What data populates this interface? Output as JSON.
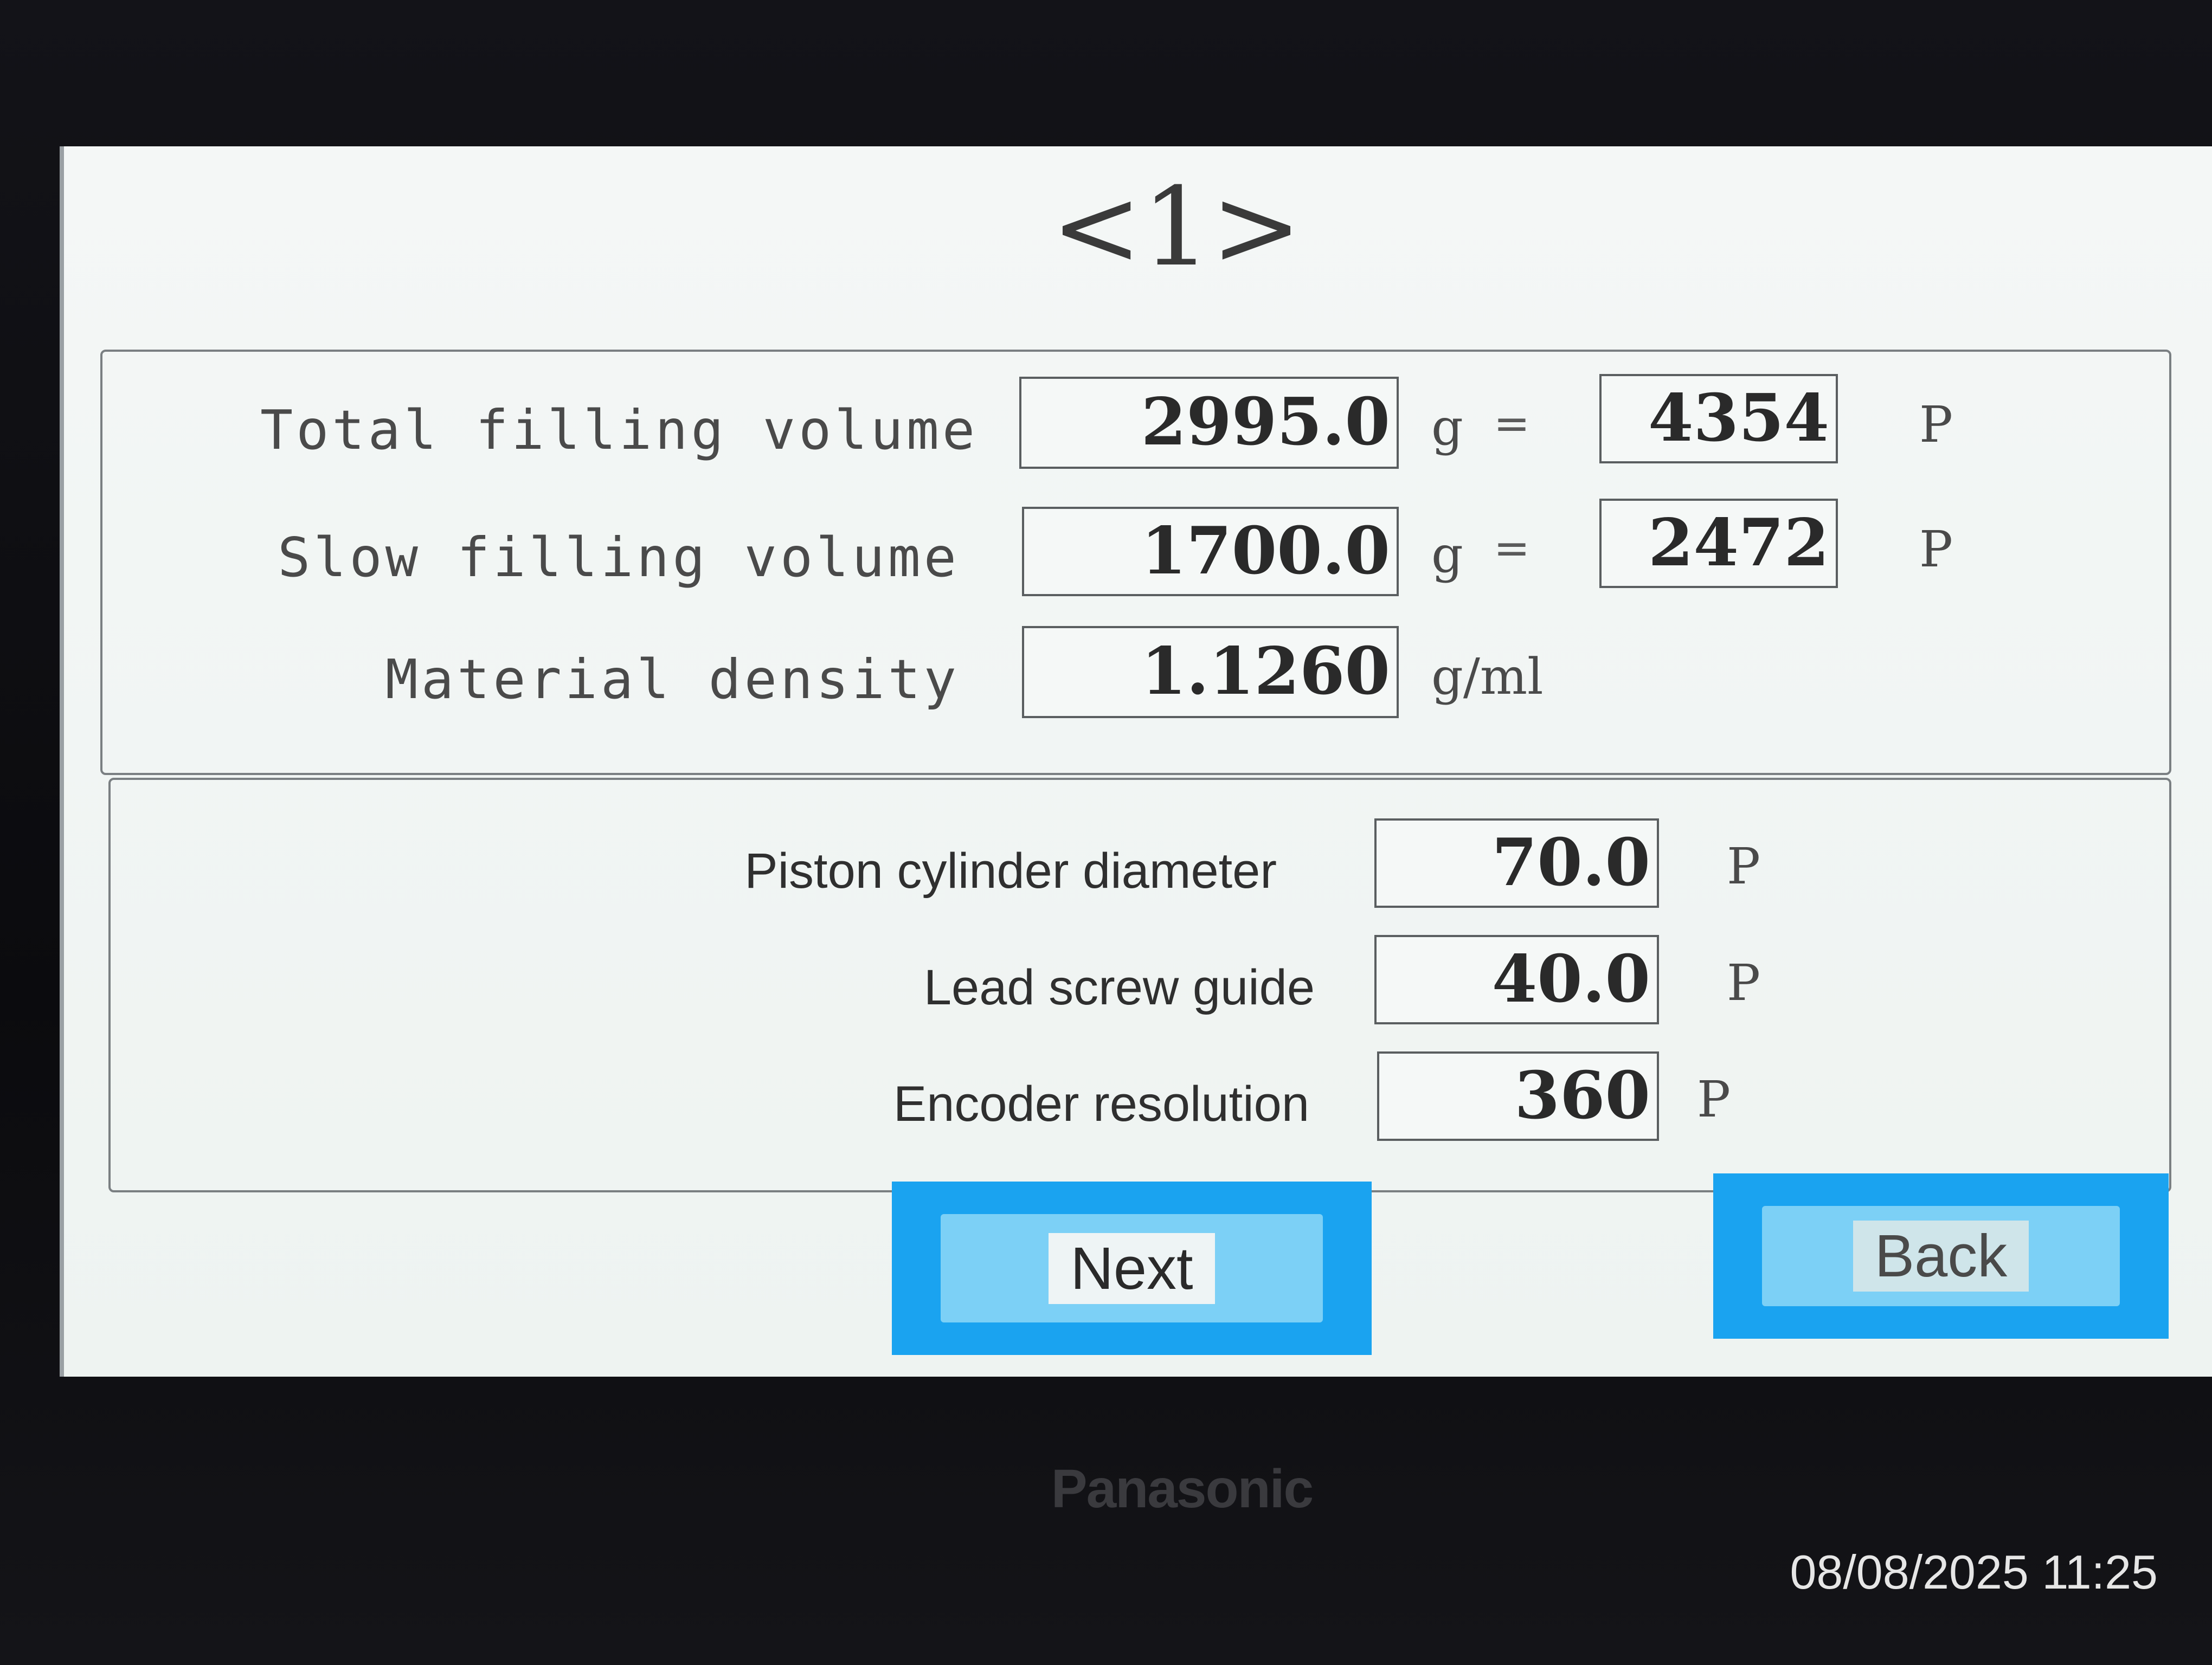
{
  "header": {
    "page_number": "<1>"
  },
  "filling": {
    "total": {
      "label": "Total filling volume",
      "value": "2995.0",
      "unit": "g",
      "equals": "=",
      "pulses": "4354",
      "pulse_unit": "P"
    },
    "slow": {
      "label": "Slow filling volume",
      "value": "1700.0",
      "unit": "g",
      "equals": "=",
      "pulses": "2472",
      "pulse_unit": "P"
    },
    "density": {
      "label": "Material density",
      "value": "1.1260",
      "unit": "g/ml"
    }
  },
  "mechanics": {
    "piston": {
      "label": "Piston cylinder diameter",
      "value": "70.0",
      "unit": "P"
    },
    "lead_screw": {
      "label": "Lead screw guide",
      "value": "40.0",
      "unit": "P"
    },
    "encoder": {
      "label": "Encoder resolution",
      "value": "360",
      "unit": "P"
    }
  },
  "buttons": {
    "next": "Next",
    "back": "Back"
  },
  "device": {
    "brand": "Panasonic"
  },
  "photo": {
    "timestamp": "08/08/2025 11:25"
  },
  "colors": {
    "button_blue": "#1aa3f0",
    "screen_bg": "#f4f7f6",
    "bezel": "#0d0d10"
  }
}
